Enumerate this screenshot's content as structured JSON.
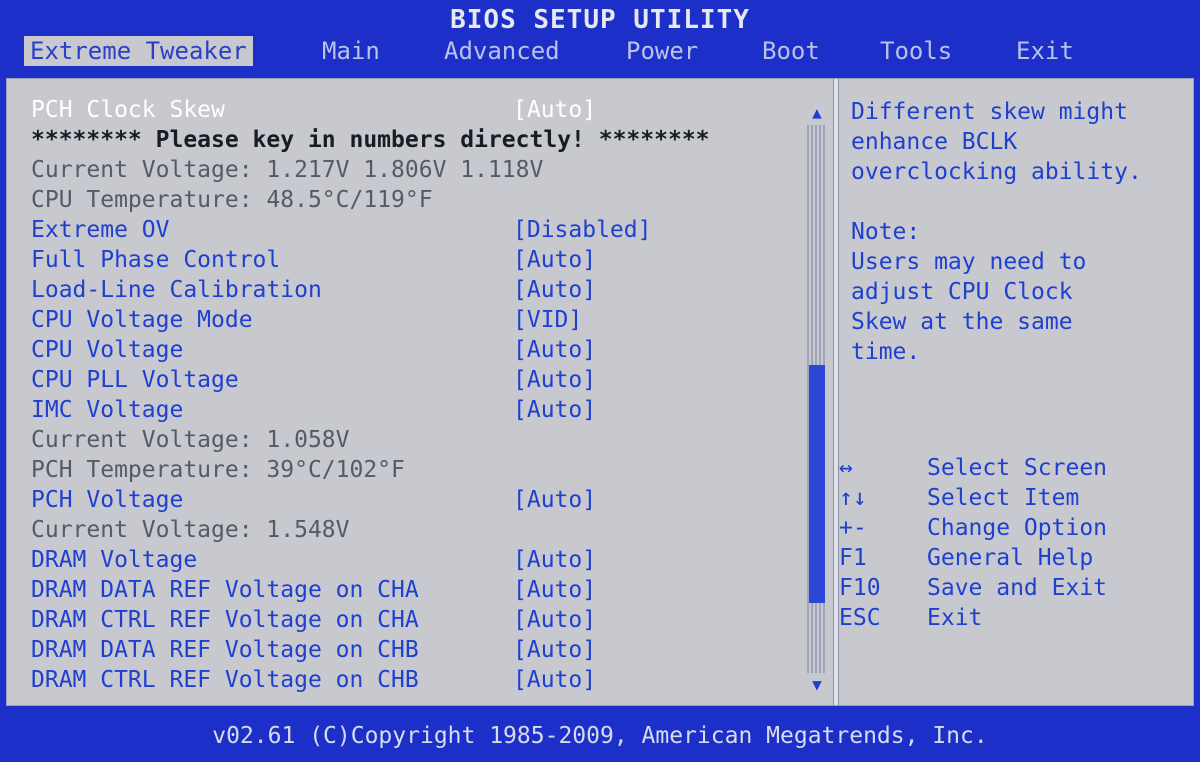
{
  "window": {
    "title": "BIOS SETUP UTILITY"
  },
  "tabs": [
    {
      "label": "Extreme Tweaker",
      "active": true
    },
    {
      "label": "Main"
    },
    {
      "label": "Advanced"
    },
    {
      "label": "Power"
    },
    {
      "label": "Boot"
    },
    {
      "label": "Tools"
    },
    {
      "label": "Exit"
    }
  ],
  "settings": [
    {
      "label": "PCH Clock Skew",
      "value": "[Auto]",
      "type": "selected"
    },
    {
      "label": "******** Please key in numbers directly! ********",
      "value": "",
      "type": "warn"
    },
    {
      "label": "Current Voltage: 1.217V  1.806V  1.118V",
      "value": "",
      "type": "info"
    },
    {
      "label": "CPU Temperature: 48.5°C/119°F",
      "value": "",
      "type": "info"
    },
    {
      "label": "Extreme OV",
      "value": "[Disabled]",
      "type": "option"
    },
    {
      "label": "Full Phase Control",
      "value": "[Auto]",
      "type": "option"
    },
    {
      "label": "Load-Line Calibration",
      "value": "[Auto]",
      "type": "option"
    },
    {
      "label": "CPU Voltage Mode",
      "value": "[VID]",
      "type": "option"
    },
    {
      "label": "CPU Voltage",
      "value": "[Auto]",
      "type": "option"
    },
    {
      "label": "CPU PLL Voltage",
      "value": "[Auto]",
      "type": "option"
    },
    {
      "label": "IMC Voltage",
      "value": "[Auto]",
      "type": "option"
    },
    {
      "label": "Current Voltage: 1.058V",
      "value": "",
      "type": "info"
    },
    {
      "label": "PCH Temperature: 39°C/102°F",
      "value": "",
      "type": "info"
    },
    {
      "label": "PCH Voltage",
      "value": "[Auto]",
      "type": "option"
    },
    {
      "label": "Current Voltage: 1.548V",
      "value": "",
      "type": "info"
    },
    {
      "label": "DRAM Voltage",
      "value": "[Auto]",
      "type": "option"
    },
    {
      "label": "DRAM DATA REF Voltage on CHA",
      "value": "[Auto]",
      "type": "option"
    },
    {
      "label": "DRAM CTRL REF Voltage on CHA",
      "value": "[Auto]",
      "type": "option"
    },
    {
      "label": "DRAM DATA REF Voltage on CHB",
      "value": "[Auto]",
      "type": "option"
    },
    {
      "label": "DRAM CTRL REF Voltage on CHB",
      "value": "[Auto]",
      "type": "option"
    }
  ],
  "help": {
    "lines": [
      "Different skew might",
      "enhance BCLK",
      "overclocking ability.",
      "",
      "Note:",
      "Users may need to",
      "adjust CPU Clock",
      "Skew at the same",
      "time."
    ]
  },
  "keys": [
    {
      "key": "↔",
      "desc": "Select Screen"
    },
    {
      "key": "↑↓",
      "desc": "Select Item"
    },
    {
      "key": "+-",
      "desc": "Change Option"
    },
    {
      "key": "F1",
      "desc": "General Help"
    },
    {
      "key": "F10",
      "desc": "Save and Exit"
    },
    {
      "key": "ESC",
      "desc": "Exit"
    }
  ],
  "scrollbar": {
    "up_arrow": "▲",
    "down_arrow": "▼"
  },
  "footer": {
    "text": "v02.61 (C)Copyright 1985-2009, American Megatrends, Inc."
  },
  "colors": {
    "frame": "#1c2fc8",
    "panel": "#c7c9cf",
    "accent": "#1f3fcf",
    "selected": "#ffffff",
    "info": "#555a66"
  }
}
